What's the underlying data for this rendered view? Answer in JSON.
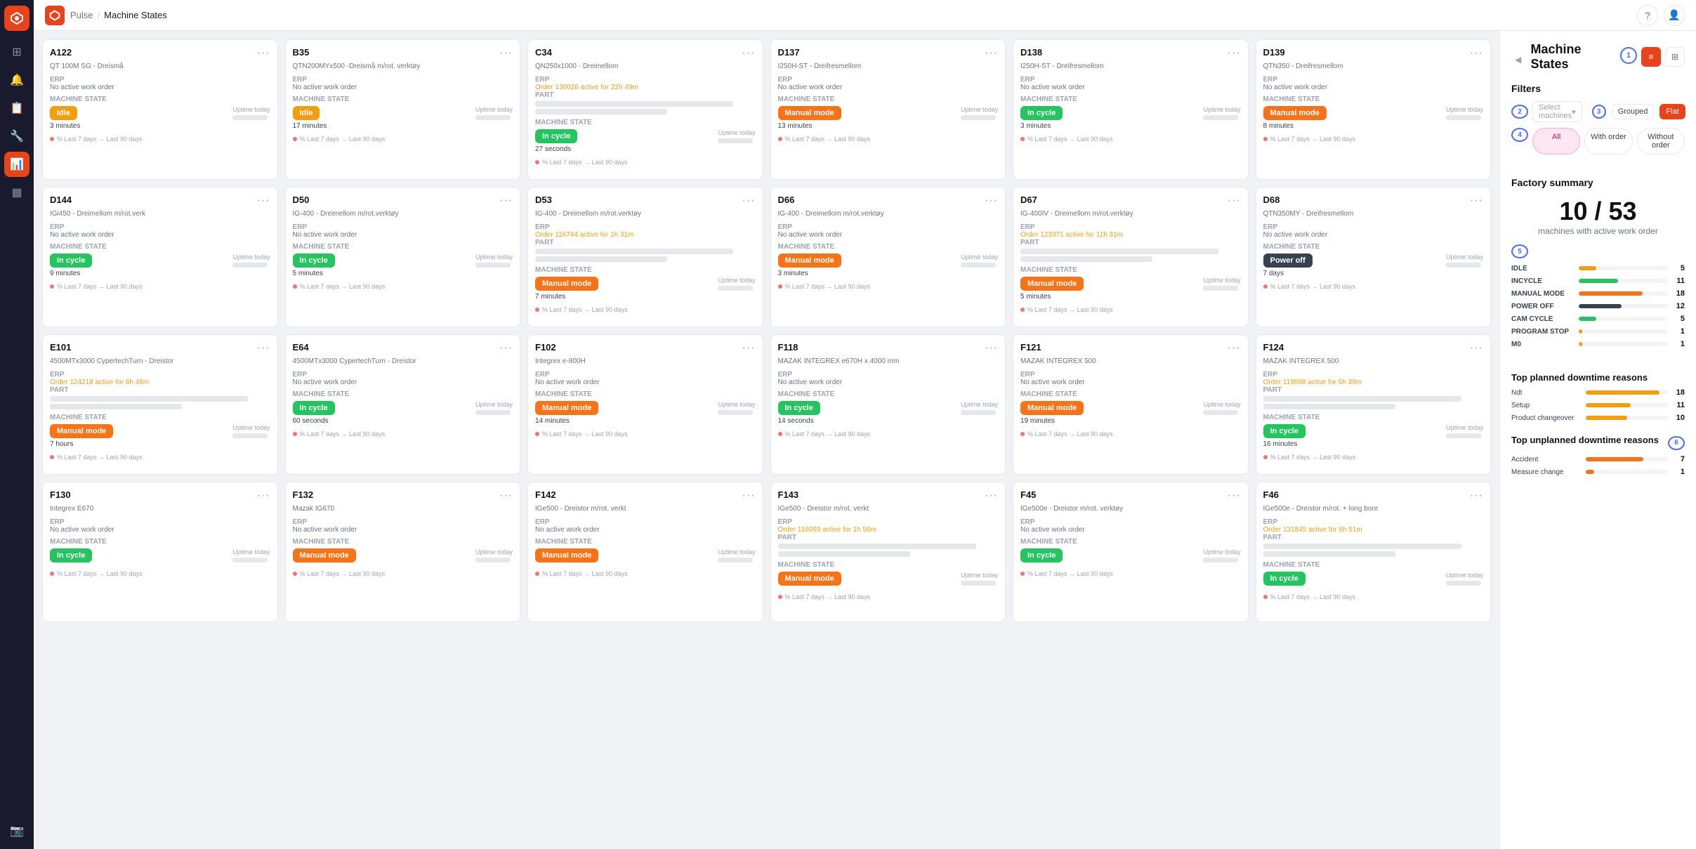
{
  "app": {
    "name": "Pulse",
    "breadcrumb": "Machine States"
  },
  "nav": {
    "items": [
      {
        "id": "home",
        "icon": "⊞",
        "active": false
      },
      {
        "id": "bell",
        "icon": "🔔",
        "active": false
      },
      {
        "id": "book",
        "icon": "📋",
        "active": false
      },
      {
        "id": "tool",
        "icon": "🔧",
        "active": false
      },
      {
        "id": "chart",
        "icon": "📊",
        "active": true
      },
      {
        "id": "grid",
        "icon": "⊞",
        "active": false
      },
      {
        "id": "camera",
        "icon": "📷",
        "active": false
      }
    ]
  },
  "panel": {
    "title": "Machine States",
    "filters_label": "Filters",
    "machines_placeholder": "Select machines",
    "grouped_label": "Grouped",
    "flat_label": "Flat",
    "order_buttons": [
      "All",
      "With order",
      "Without order"
    ],
    "active_order": "All",
    "factory_summary_title": "Factory summary",
    "fraction": "10 / 53",
    "fraction_sub": "machines with active work order",
    "states": [
      {
        "label": "IDLE",
        "count": 5,
        "pct": 20,
        "color": "bar-idle"
      },
      {
        "label": "INCYCLE",
        "count": 11,
        "pct": 44,
        "color": "bar-incycle"
      },
      {
        "label": "MANUAL MODE",
        "count": 18,
        "pct": 72,
        "color": "bar-manual"
      },
      {
        "label": "POWER OFF",
        "count": 12,
        "pct": 48,
        "color": "bar-poweroff"
      },
      {
        "label": "CAM CYCLE",
        "count": 5,
        "pct": 20,
        "color": "bar-camcycle"
      },
      {
        "label": "PROGRAM STOP",
        "count": 1,
        "pct": 4,
        "color": "bar-programstop"
      },
      {
        "label": "M0",
        "count": 1,
        "pct": 4,
        "color": "bar-m0"
      }
    ],
    "planned_downtime_title": "Top planned downtime reasons",
    "planned": [
      {
        "label": "Ndt",
        "count": 18,
        "pct": 90,
        "color": "bar-planned"
      },
      {
        "label": "Setup",
        "count": 11,
        "pct": 55,
        "color": "bar-planned"
      },
      {
        "label": "Product changeover",
        "count": 10,
        "pct": 50,
        "color": "bar-planned"
      }
    ],
    "unplanned_downtime_title": "Top unplanned downtime reasons",
    "unplanned": [
      {
        "label": "Accident",
        "count": 7,
        "pct": 70,
        "color": "bar-unplanned"
      },
      {
        "label": "Measure change",
        "count": 1,
        "pct": 10,
        "color": "bar-unplanned"
      }
    ]
  },
  "machines": [
    {
      "id": "A122",
      "subtitle": "QT 100M SG - Dreismå",
      "erp": "No active work order",
      "state_type": "idle",
      "state_label": "Idle",
      "state_time": "3 minutes",
      "has_part": false,
      "has_order": false
    },
    {
      "id": "B35",
      "subtitle": "QTN200MYx500 -Dreismå m/rot. verktøy",
      "erp": "No active work order",
      "state_type": "idle",
      "state_label": "Idle",
      "state_time": "17 minutes",
      "has_part": false,
      "has_order": false
    },
    {
      "id": "C34",
      "subtitle": "QN250x1000 - Dreimellom",
      "erp_order": "Order 130026 active for 22h 49m",
      "state_type": "incycle",
      "state_label": "In cycle",
      "state_time": "27 seconds",
      "has_part": true,
      "has_order": true
    },
    {
      "id": "D137",
      "subtitle": "I250H-ST - Dreifresmellom",
      "erp": "No active work order",
      "state_type": "manual",
      "state_label": "Manual mode",
      "state_time": "13 minutes",
      "has_part": false,
      "has_order": false
    },
    {
      "id": "D138",
      "subtitle": "I250H-ST - Dreifresmellom",
      "erp": "No active work order",
      "state_type": "incycle",
      "state_label": "In cycle",
      "state_time": "3 minutes",
      "has_part": false,
      "has_order": false
    },
    {
      "id": "D139",
      "subtitle": "QTN350 - Dreifresmellom",
      "erp": "No active work order",
      "state_type": "manual",
      "state_label": "Manual mode",
      "state_time": "8 minutes",
      "has_part": false,
      "has_order": false
    },
    {
      "id": "D144",
      "subtitle": "IGi450 - Dreimellom m/rot.verk",
      "erp": "No active work order",
      "state_type": "incycle",
      "state_label": "In cycle",
      "state_time": "9 minutes",
      "has_part": false,
      "has_order": false
    },
    {
      "id": "D50",
      "subtitle": "IG-400 - Dreimellom m/rot.verktøy",
      "erp": "No active work order",
      "state_type": "incycle",
      "state_label": "In cycle",
      "state_time": "5 minutes",
      "has_part": false,
      "has_order": false
    },
    {
      "id": "D53",
      "subtitle": "IG-400 - Dreimellom m/rot.verktøy",
      "erp_order": "Order 116744 active for 1h 31m",
      "state_type": "manual",
      "state_label": "Manual mode",
      "state_time": "7 minutes",
      "has_part": true,
      "has_order": true
    },
    {
      "id": "D66",
      "subtitle": "IG-400 - Dreimellom m/rot.verktøy",
      "erp": "No active work order",
      "state_type": "manual",
      "state_label": "Manual mode",
      "state_time": "3 minutes",
      "has_part": false,
      "has_order": false
    },
    {
      "id": "D67",
      "subtitle": "IG-400IV - Dreimellom m/rot.verktøy",
      "erp_order": "Order 123371 active for 11h 31m",
      "state_type": "manual",
      "state_label": "Manual mode",
      "state_time": "5 minutes",
      "has_part": true,
      "has_order": true
    },
    {
      "id": "D68",
      "subtitle": "QTN350MY - Dreifresmellom",
      "erp": "No active work order",
      "state_type": "poweroff",
      "state_label": "Power off",
      "state_time": "7 days",
      "has_part": false,
      "has_order": false
    },
    {
      "id": "E101",
      "subtitle": "4500MTx3000 CypertechTurn - Dreistor",
      "erp_order": "Order 124218 active for 6h 48m",
      "state_type": "manual",
      "state_label": "Manual mode",
      "state_time": "7 hours",
      "has_part": true,
      "has_order": true
    },
    {
      "id": "E64",
      "subtitle": "4500MTx3000 CypertechTurn - Dreistor",
      "erp": "No active work order",
      "state_type": "incycle",
      "state_label": "In cycle",
      "state_time": "60 seconds",
      "has_part": false,
      "has_order": false
    },
    {
      "id": "F102",
      "subtitle": "Integrex e-800H",
      "erp": "No active work order",
      "state_type": "manual",
      "state_label": "Manual mode",
      "state_time": "14 minutes",
      "has_part": false,
      "has_order": false
    },
    {
      "id": "F118",
      "subtitle": "MAZAK INTEGREX e670H x 4000 mm",
      "erp": "No active work order",
      "state_type": "incycle",
      "state_label": "In cycle",
      "state_time": "14 seconds",
      "has_part": false,
      "has_order": false
    },
    {
      "id": "F121",
      "subtitle": "MAZAK INTEGREX 500",
      "erp": "No active work order",
      "state_type": "manual",
      "state_label": "Manual mode",
      "state_time": "19 minutes",
      "has_part": false,
      "has_order": false
    },
    {
      "id": "F124",
      "subtitle": "MAZAK INTEGREX 500",
      "erp_order": "Order 119898 active for 6h 39m",
      "state_type": "incycle",
      "state_label": "In cycle",
      "state_time": "16 minutes",
      "has_part": true,
      "has_order": true
    },
    {
      "id": "F130",
      "subtitle": "Integrex E670",
      "erp": "No active work order",
      "state_type": "incycle",
      "state_label": "In cycle",
      "state_time": "",
      "has_part": false,
      "has_order": false
    },
    {
      "id": "F132",
      "subtitle": "Mazak IG670",
      "erp": "No active work order",
      "state_type": "manual",
      "state_label": "Manual mode",
      "state_time": "",
      "has_part": false,
      "has_order": false
    },
    {
      "id": "F142",
      "subtitle": "IGe500 - Dreistor m/rot. verkt",
      "erp": "No active work order",
      "state_type": "manual",
      "state_label": "Manual mode",
      "state_time": "",
      "has_part": false,
      "has_order": false
    },
    {
      "id": "F143",
      "subtitle": "IGe500 - Dreistor m/rot. verkt",
      "erp_order": "Order 116093 active for 1h 56m",
      "state_type": "manual",
      "state_label": "Manual mode",
      "state_time": "",
      "has_part": true,
      "has_order": true
    },
    {
      "id": "F45",
      "subtitle": "IGe500e - Dreistor m/rot. verktøy",
      "erp": "No active work order",
      "state_type": "incycle",
      "state_label": "In cycle",
      "state_time": "",
      "has_part": false,
      "has_order": false
    },
    {
      "id": "F46",
      "subtitle": "IGe500e - Dreistor m/rot. + long bore",
      "erp_order": "Order 131845 active for 6h 51m",
      "state_type": "incycle",
      "state_label": "In cycle",
      "state_time": "",
      "has_part": true,
      "has_order": true
    }
  ]
}
